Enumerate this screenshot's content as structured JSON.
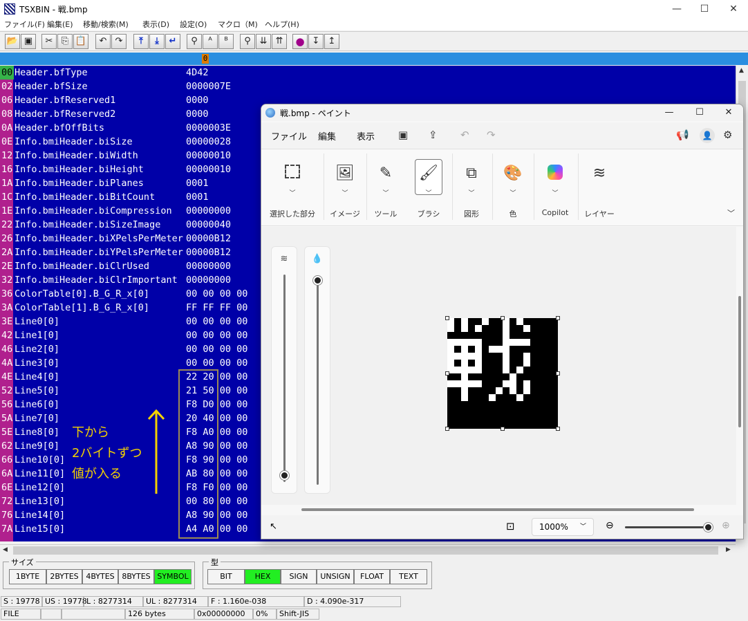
{
  "window": {
    "title": "TSXBIN - 戦.bmp",
    "minimize_icon": "—",
    "maximize_icon": "☐",
    "close_icon": "✕"
  },
  "menu": [
    "ファイル(F)",
    "編集(E)",
    "移動/検索(M)",
    "表示(D)",
    "設定(O)",
    "マクロ（M)",
    "ヘルプ(H)"
  ],
  "column_header": "0",
  "rows": [
    {
      "off": "00",
      "name": "Header.bfType",
      "value": "4D42"
    },
    {
      "off": "02",
      "name": "Header.bfSize",
      "value": "0000007E"
    },
    {
      "off": "06",
      "name": "Header.bfReserved1",
      "value": "0000"
    },
    {
      "off": "08",
      "name": "Header.bfReserved2",
      "value": "0000"
    },
    {
      "off": "0A",
      "name": "Header.bfOffBits",
      "value": "0000003E"
    },
    {
      "off": "0E",
      "name": "Info.bmiHeader.biSize",
      "value": "00000028"
    },
    {
      "off": "12",
      "name": "Info.bmiHeader.biWidth",
      "value": "00000010"
    },
    {
      "off": "16",
      "name": "Info.bmiHeader.biHeight",
      "value": "00000010"
    },
    {
      "off": "1A",
      "name": "Info.bmiHeader.biPlanes",
      "value": "0001"
    },
    {
      "off": "1C",
      "name": "Info.bmiHeader.biBitCount",
      "value": "0001"
    },
    {
      "off": "1E",
      "name": "Info.bmiHeader.biCompression",
      "value": "00000000"
    },
    {
      "off": "22",
      "name": "Info.bmiHeader.biSizeImage",
      "value": "00000040"
    },
    {
      "off": "26",
      "name": "Info.bmiHeader.biXPelsPerMeter",
      "value": "00000B12"
    },
    {
      "off": "2A",
      "name": "Info.bmiHeader.biYPelsPerMeter",
      "value": "00000B12"
    },
    {
      "off": "2E",
      "name": "Info.bmiHeader.biClrUsed",
      "value": "00000000"
    },
    {
      "off": "32",
      "name": "Info.bmiHeader.biClrImportant",
      "value": "00000000"
    },
    {
      "off": "36",
      "name": "ColorTable[0].B_G_R_x[0]",
      "value": "00 00 00 00"
    },
    {
      "off": "3A",
      "name": "ColorTable[1].B_G_R_x[0]",
      "value": "FF FF FF 00"
    },
    {
      "off": "3E",
      "name": "Line0[0]",
      "value": "00 00 00 00"
    },
    {
      "off": "42",
      "name": "Line1[0]",
      "value": "00 00 00 00"
    },
    {
      "off": "46",
      "name": "Line2[0]",
      "value": "00 00 00 00"
    },
    {
      "off": "4A",
      "name": "Line3[0]",
      "value": "00 00 00 00"
    },
    {
      "off": "4E",
      "name": "Line4[0]",
      "value": "22 20 00 00"
    },
    {
      "off": "52",
      "name": "Line5[0]",
      "value": "21 50 00 00"
    },
    {
      "off": "56",
      "name": "Line6[0]",
      "value": "F8 D0 00 00"
    },
    {
      "off": "5A",
      "name": "Line7[0]",
      "value": "20 40 00 00"
    },
    {
      "off": "5E",
      "name": "Line8[0]",
      "value": "F8 A0 00 00"
    },
    {
      "off": "62",
      "name": "Line9[0]",
      "value": "A8 90 00 00"
    },
    {
      "off": "66",
      "name": "Line10[0]",
      "value": "F8 90 00 00"
    },
    {
      "off": "6A",
      "name": "Line11[0]",
      "value": "AB 80 00 00"
    },
    {
      "off": "6E",
      "name": "Line12[0]",
      "value": "F8 F0 00 00"
    },
    {
      "off": "72",
      "name": "Line13[0]",
      "value": "00 80 00 00"
    },
    {
      "off": "76",
      "name": "Line14[0]",
      "value": "A8 90 00 00"
    },
    {
      "off": "7A",
      "name": "Line15[0]",
      "value": "A4 A0 00 00"
    }
  ],
  "annotation": {
    "line1": "下から",
    "line2": "2バイトずつ",
    "line3": "値が入る"
  },
  "size_group": {
    "label": "サイズ",
    "buttons": [
      "1BYTE",
      "2BYTES",
      "4BYTES",
      "8BYTES",
      "SYMBOL"
    ],
    "selected": "SYMBOL"
  },
  "type_group": {
    "label": "型",
    "buttons": [
      "BIT",
      "HEX",
      "SIGN",
      "UNSIGN",
      "FLOAT",
      "TEXT"
    ],
    "selected": "HEX"
  },
  "status1": {
    "s": "S : 19778",
    "us": "US : 19778",
    "l": "L :    8277314",
    "ul": "UL :    8277314",
    "f": "F :        1.160e-038",
    "d": "D :          4.090e-317"
  },
  "status2": {
    "mode": "FILE",
    "size": "126 bytes",
    "addr": "0x00000000",
    "percent": "0%",
    "encoding": "Shift-JIS"
  },
  "paint": {
    "title": "戦.bmp - ペイント",
    "menu": [
      "ファイル",
      "編集",
      "表示"
    ],
    "ribbon": [
      "選択した部分",
      "イメージ",
      "ツール",
      "ブラシ",
      "図形",
      "色",
      "Copilot",
      "レイヤー"
    ],
    "zoom": "1000%",
    "bitmap_rows_bottom_up": [
      "00 00",
      "00 00",
      "00 00",
      "00 00",
      "22 20",
      "21 50",
      "F8 D0",
      "20 40",
      "F8 A0",
      "A8 90",
      "F8 90",
      "AB 80",
      "F8 F0",
      "00 80",
      "A8 90",
      "A4 A0"
    ]
  },
  "colors": {
    "dump_bg": "#0000a8",
    "offset_bg": "#b0208e",
    "header_bar": "#2a8ee0",
    "selected_green": "#22ee22",
    "annotation_yellow": "#f4d200"
  }
}
